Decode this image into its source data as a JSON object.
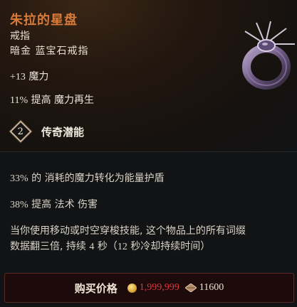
{
  "item": {
    "name": "朱拉的星盘",
    "type": "戒指",
    "rarity_line": "暗金 蓝宝石戒指"
  },
  "implicit_stats": [
    {
      "value": "+13",
      "text": "魔力"
    },
    {
      "value": "11%",
      "text": "提高 魔力再生"
    }
  ],
  "legendary": {
    "potential": "2",
    "label": "传奇潜能"
  },
  "affixes": [
    {
      "value": "33%",
      "text": "的 消耗的魔力转化为能量护盾"
    },
    {
      "value": "38%",
      "text": "提高 法术 伤害"
    },
    {
      "text_a": "当你使用移动或时空穿梭技能, 这个物品上的所有词缀",
      "text_b": "数据翻三倍, 持续",
      "num1": "4",
      "text_c": "秒（",
      "num2": "12",
      "text_d": "秒冷却持续时间）"
    }
  ],
  "purchase": {
    "label": "购买价格",
    "gold_price": "1,999,999",
    "shard_price": "11600"
  },
  "colors": {
    "title": "#d97a39",
    "gold_price": "#e0353a"
  },
  "icons": [
    "ring-item-icon",
    "legendary-diamond-icon",
    "gold-coin-icon",
    "shard-currency-icon"
  ]
}
